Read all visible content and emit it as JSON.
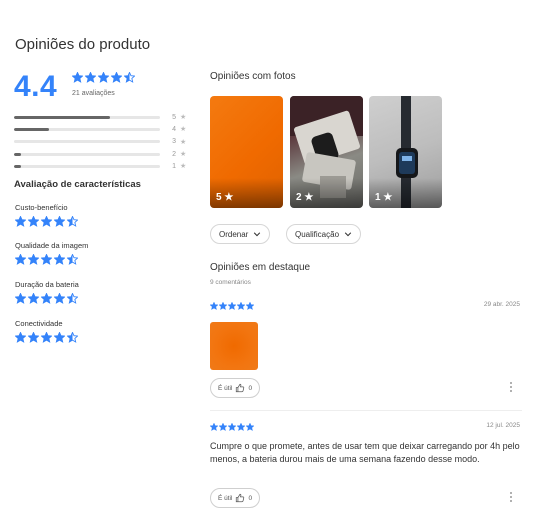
{
  "page": {
    "title": "Opiniões do produto"
  },
  "summary": {
    "rating": "4.4",
    "review_count": "21 avaliações",
    "stars_value": 4.5,
    "distribution": [
      {
        "label": "5",
        "fraction": 0.66
      },
      {
        "label": "4",
        "fraction": 0.24
      },
      {
        "label": "3",
        "fraction": 0.0
      },
      {
        "label": "2",
        "fraction": 0.05
      },
      {
        "label": "1",
        "fraction": 0.05
      }
    ]
  },
  "characteristics": {
    "title": "Avaliação de características",
    "items": [
      {
        "label": "Custo-benefício",
        "stars": 4.5
      },
      {
        "label": "Qualidade da imagem",
        "stars": 4.5
      },
      {
        "label": "Duração da bateria",
        "stars": 4.5
      },
      {
        "label": "Conectividade",
        "stars": 4.5
      }
    ]
  },
  "photos": {
    "title": "Opiniões com fotos",
    "items": [
      {
        "label": "5 ★"
      },
      {
        "label": "2 ★"
      },
      {
        "label": "1 ★"
      }
    ]
  },
  "filters": {
    "sort_label": "Ordenar",
    "rating_label": "Qualificação"
  },
  "featured": {
    "title": "Opiniões em destaque",
    "count": "9 comentários",
    "reviews": [
      {
        "stars": 5,
        "date": "29 abr. 2025",
        "text": "",
        "useful_label": "É útil",
        "useful_count": "0"
      },
      {
        "stars": 5,
        "date": "12 jul. 2025",
        "text": "Cumpre o que promete, antes de usar tem que deixar carregando por 4h pelo menos, a bateria durou mais de uma semana fazendo desse modo.",
        "useful_label": "É útil",
        "useful_count": "0"
      }
    ]
  },
  "colors": {
    "accent": "#3483fa",
    "star": "#3483fa"
  },
  "icons": {
    "star": "star-icon",
    "half_star": "half-star-icon",
    "chevron": "chevron-down-icon",
    "thumb": "thumbs-up-icon",
    "menu": "kebab-menu-icon"
  }
}
